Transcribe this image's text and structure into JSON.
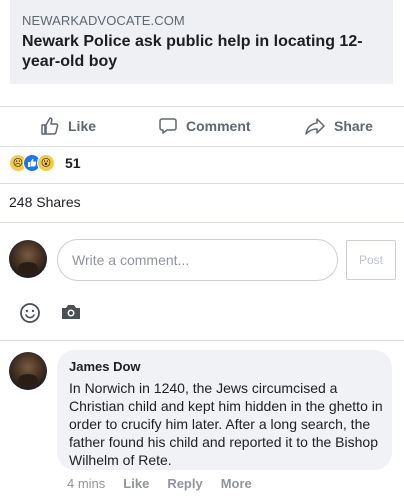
{
  "link": {
    "domain": "NEWARKADVOCATE.COM",
    "title": "Newark Police ask public help in locating 12-year-old boy"
  },
  "actions": {
    "like": "Like",
    "comment": "Comment",
    "share": "Share"
  },
  "reactions": {
    "icons": [
      "sad-icon",
      "like-icon",
      "wow-icon"
    ],
    "count": "51"
  },
  "shares": "248 Shares",
  "composer": {
    "placeholder": "Write a comment...",
    "post": "Post"
  },
  "comment": {
    "author": "James Dow",
    "text": "In Norwich in 1240, the Jews circumcised a Christian child and kept him hidden in the ghetto in order to crucify him later. After a long search, the father found his child and reported it to the Bishop Wilhelm of Rete.",
    "time": "4 mins",
    "like": "Like",
    "reply": "Reply",
    "more": "More"
  },
  "colors": {
    "accent": "#1877f2",
    "muted": "#606770",
    "bubble": "#f0f2f5"
  }
}
